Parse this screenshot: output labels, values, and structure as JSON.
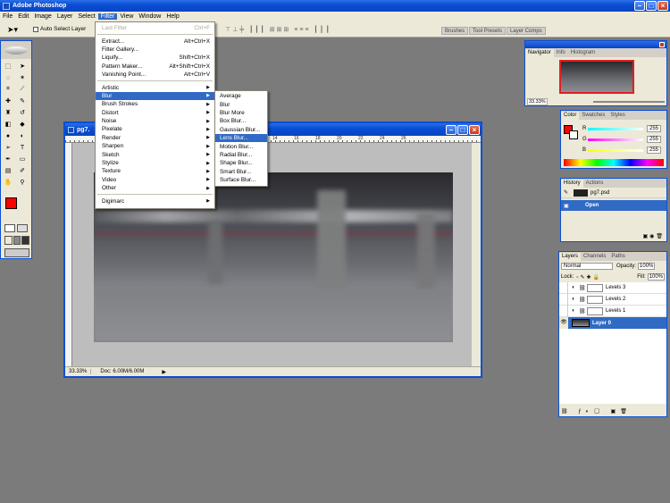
{
  "app": {
    "title": "Adobe Photoshop"
  },
  "menubar": [
    "File",
    "Edit",
    "Image",
    "Layer",
    "Select",
    "Filter",
    "View",
    "Window",
    "Help"
  ],
  "options": {
    "auto_select": "Auto Select Layer",
    "well_tabs": [
      "Brushes",
      "Tool Presets",
      "Layer Comps"
    ]
  },
  "filter_menu": {
    "last_filter": "Last Filter",
    "last_filter_sc": "Ctrl+F",
    "top": [
      {
        "label": "Extract...",
        "sc": "Alt+Ctrl+X"
      },
      {
        "label": "Filter Gallery...",
        "sc": ""
      },
      {
        "label": "Liquify...",
        "sc": "Shift+Ctrl+X"
      },
      {
        "label": "Pattern Maker...",
        "sc": "Alt+Shift+Ctrl+X"
      },
      {
        "label": "Vanishing Point...",
        "sc": "Alt+Ctrl+V"
      }
    ],
    "categories": [
      "Artistic",
      "Blur",
      "Brush Strokes",
      "Distort",
      "Noise",
      "Pixelate",
      "Render",
      "Sharpen",
      "Sketch",
      "Stylize",
      "Texture",
      "Video",
      "Other"
    ],
    "bottom": "Digimarc"
  },
  "blur_menu": [
    "Average",
    "Blur",
    "Blur More",
    "Box Blur...",
    "Gaussian Blur...",
    "Lens Blur...",
    "Motion Blur...",
    "Radial Blur...",
    "Shape Blur...",
    "Smart Blur...",
    "Surface Blur..."
  ],
  "document": {
    "title": "pg7.",
    "zoom": "33.33%",
    "doc_info": "Doc: 6.00M/6.00M",
    "ruler_marks": [
      "14",
      "16",
      "18",
      "20",
      "22",
      "24",
      "26"
    ]
  },
  "navigator": {
    "tabs": [
      "Navigator",
      "Info",
      "Histogram"
    ],
    "zoom": "33.33%"
  },
  "color": {
    "tabs": [
      "Color",
      "Swatches",
      "Styles"
    ],
    "channels": [
      {
        "label": "R",
        "value": "255"
      },
      {
        "label": "G",
        "value": "255"
      },
      {
        "label": "B",
        "value": "255"
      }
    ],
    "fg": "#ff0000",
    "bg": "#ffffff"
  },
  "history": {
    "tabs": [
      "History",
      "Actions"
    ],
    "snapshot": "pg7.psd",
    "state": "Open"
  },
  "layers": {
    "tabs": [
      "Layers",
      "Channels",
      "Paths"
    ],
    "blend": "Normal",
    "opacity_label": "Opacity:",
    "opacity": "100%",
    "lock_label": "Lock:",
    "fill_label": "Fill:",
    "fill": "100%",
    "items": [
      "Levels 3",
      "Levels 2",
      "Levels 1",
      "Layer 0"
    ]
  }
}
